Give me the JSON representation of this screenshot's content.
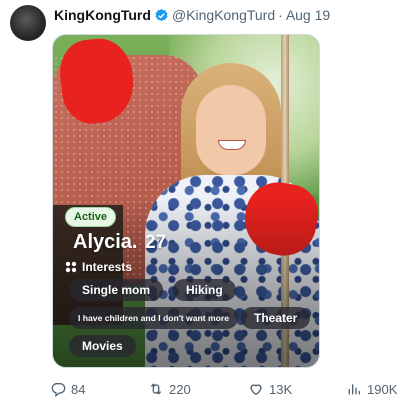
{
  "tweet": {
    "display_name": "KingKongTurd",
    "handle": "@KingKongTurd",
    "separator": "·",
    "date": "Aug 19",
    "verified_color": "#1d9bf0"
  },
  "profile_card": {
    "status_badge": "Active",
    "name": "Alycia.",
    "age": "27",
    "interests_label": "Interests",
    "chips": [
      "Single mom",
      "Hiking",
      "I have children and I don't want more",
      "Theater",
      "Movies"
    ],
    "redaction_color": "#e8221e"
  },
  "actions": {
    "replies": "84",
    "reposts": "220",
    "likes": "13K",
    "views": "190K"
  }
}
